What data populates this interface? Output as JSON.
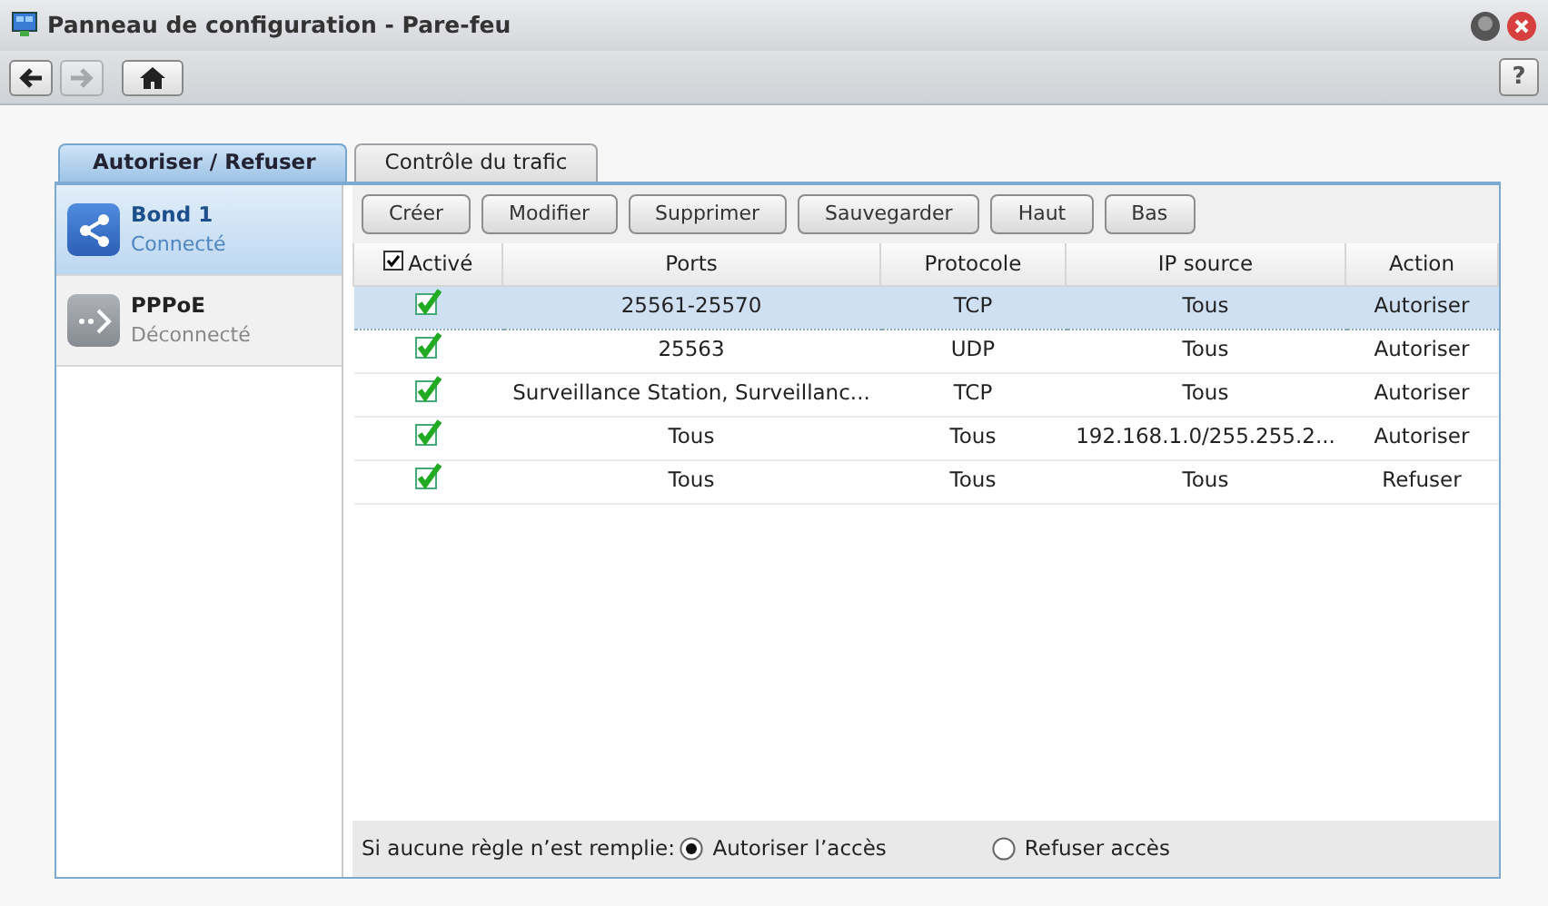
{
  "window": {
    "title": "Panneau de configuration - Pare-feu"
  },
  "toolbar": {
    "back_disabled": false,
    "forward_disabled": true,
    "help_label": "?"
  },
  "tabs": [
    {
      "label": "Autoriser / Refuser",
      "selected": true
    },
    {
      "label": "Contrôle du trafic",
      "selected": false
    }
  ],
  "sidebar": {
    "items": [
      {
        "name": "Bond 1",
        "status": "Connecté",
        "selected": true,
        "connected": true
      },
      {
        "name": "PPPoE",
        "status": "Déconnecté",
        "selected": false,
        "connected": false
      }
    ]
  },
  "buttons": [
    "Créer",
    "Modifier",
    "Supprimer",
    "Sauvegarder",
    "Haut",
    "Bas"
  ],
  "table": {
    "header_checked": true,
    "columns": [
      "Activé",
      "Ports",
      "Protocole",
      "IP source",
      "Action"
    ],
    "rows": [
      {
        "enabled": true,
        "selected": true,
        "ports": "25561-25570",
        "protocol": "TCP",
        "source_ip": "Tous",
        "action": "Autoriser"
      },
      {
        "enabled": true,
        "selected": false,
        "ports": "25563",
        "protocol": "UDP",
        "source_ip": "Tous",
        "action": "Autoriser"
      },
      {
        "enabled": true,
        "selected": false,
        "ports": "Surveillance Station, Surveillanc...",
        "protocol": "TCP",
        "source_ip": "Tous",
        "action": "Autoriser"
      },
      {
        "enabled": true,
        "selected": false,
        "ports": "Tous",
        "protocol": "Tous",
        "source_ip": "192.168.1.0/255.255.2...",
        "action": "Autoriser"
      },
      {
        "enabled": true,
        "selected": false,
        "ports": "Tous",
        "protocol": "Tous",
        "source_ip": "Tous",
        "action": "Refuser"
      }
    ]
  },
  "default_rule": {
    "label": "Si aucune règle n’est remplie:",
    "options": [
      {
        "label": "Autoriser l’accès",
        "selected": true
      },
      {
        "label": "Refuser accès",
        "selected": false
      }
    ]
  }
}
